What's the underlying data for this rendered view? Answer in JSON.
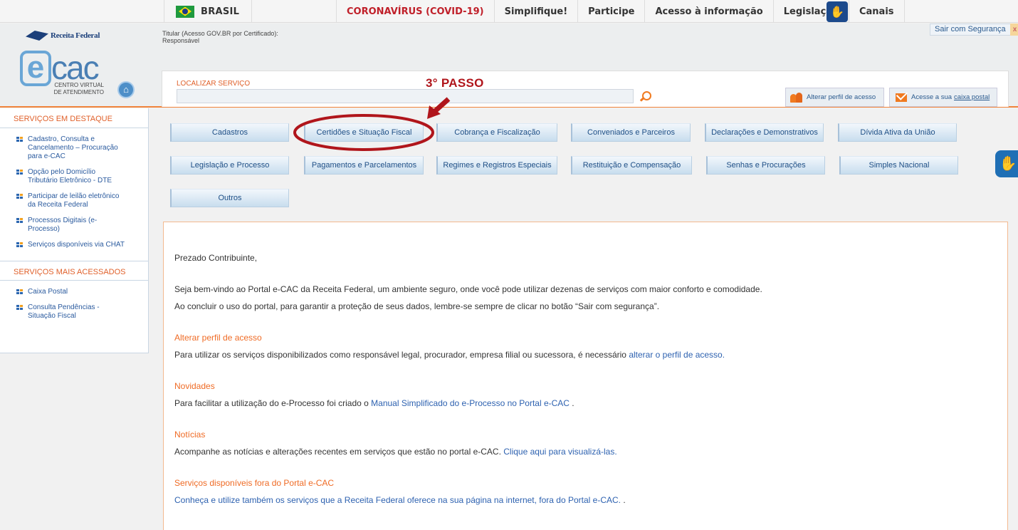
{
  "govbar": {
    "brasil": "BRASIL",
    "nav": [
      "CORONAVÍRUS (COVID-19)",
      "Simplifique!",
      "Participe",
      "Acesso à informação",
      "Legislação",
      "Canais"
    ]
  },
  "header": {
    "rf_name": "Receita Federal",
    "ecac_sub": "CENTRO VIRTUAL DE ATENDIMENTO",
    "titular_line1": "Titular (Acesso GOV.BR por Certificado):",
    "titular_line2": "Responsável",
    "sair": "Sair com Segurança",
    "sair_x": "x"
  },
  "search": {
    "label": "LOCALIZAR SERVIÇO",
    "value": "",
    "btn_perfil": "Alterar perfil de acesso",
    "btn_caixa_prefix": "Acesse a sua",
    "btn_caixa_link": "caixa postal"
  },
  "sidebar": {
    "destaque_title": "SERVIÇOS EM DESTAQUE",
    "destaque": [
      "Cadastro, Consulta e Cancelamento – Procuração para e-CAC",
      "Opção pelo Domicílio Tributário Eletrônico - DTE",
      "Participar de leilão eletrônico da Receita Federal",
      "Processos Digitais (e-Processo)",
      "Serviços disponíveis via CHAT"
    ],
    "acessados_title": "SERVIÇOS MAIS ACESSADOS",
    "acessados": [
      "Caixa Postal",
      "Consulta Pendências - Situação Fiscal"
    ]
  },
  "categories": [
    "Cadastros",
    "Certidões e Situação Fiscal",
    "Cobrança e Fiscalização",
    "Conveniados e Parceiros",
    "Declarações e Demonstrativos",
    "Dívida Ativa da União",
    "Legislação e Processo",
    "Pagamentos e Parcelamentos",
    "Regimes e Registros Especiais",
    "Restituição e Compensação",
    "Senhas e Procurações",
    "Simples Nacional",
    "Outros"
  ],
  "annotation": {
    "step": "3° PASSO",
    "color": "#b0151b"
  },
  "content": {
    "greeting": "Prezado Contribuinte,",
    "welcome": "Seja bem-vindo ao Portal e-CAC da Receita Federal, um ambiente seguro, onde você pode utilizar dezenas de serviços com maior conforto e comodidade.",
    "reminder": "Ao concluir o uso do portal, para garantir a proteção de seus dados, lembre-se sempre de clicar no botão “Sair com segurança”.",
    "perfil_title": "Alterar perfil de acesso",
    "perfil_text": "Para utilizar os serviços disponibilizados como responsável legal, procurador, empresa filial ou sucessora, é necessário",
    "perfil_link": "alterar o perfil de acesso.",
    "novidades_title": "Novidades",
    "novidades_text": "Para facilitar a utilização do e-Processo foi criado o",
    "novidades_link": "Manual Simplificado do e-Processo no Portal e-CAC",
    "novidades_end": ".",
    "noticias_title": "Notícias",
    "noticias_text": "Acompanhe as notícias e alterações recentes em serviços que estão no portal e-CAC.",
    "noticias_link": "Clique aqui para visualizá-las.",
    "fora_title": "Serviços disponíveis fora do Portal e-CAC",
    "fora_link": "Conheça e utilize também os serviços que a Receita Federal oferece na sua página na internet, fora do Portal e-CAC.",
    "fora_end": " ."
  },
  "colors": {
    "accent": "#f0833a",
    "link": "#2e62b0",
    "brand_blue": "#1b3f7a"
  }
}
